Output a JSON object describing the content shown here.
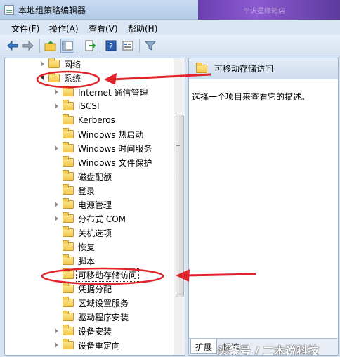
{
  "window": {
    "title": "本地组策略编辑器",
    "background_text": "平沢星缘箱店"
  },
  "menu": [
    {
      "label": "文件(F)"
    },
    {
      "label": "操作(A)"
    },
    {
      "label": "查看(V)"
    },
    {
      "label": "帮助(H)"
    }
  ],
  "toolbar": {
    "icons": [
      "back-arrow-icon",
      "forward-arrow-icon",
      "up-folder-icon",
      "show-tree-icon",
      "export-list-icon",
      "help-icon",
      "properties-icon",
      "filter-icon"
    ]
  },
  "tree": [
    {
      "label": "网络",
      "expander": "collapsed",
      "level": 0
    },
    {
      "label": "系统",
      "expander": "expanded",
      "level": 0
    },
    {
      "label": "Internet 通信管理",
      "expander": "collapsed",
      "level": 1
    },
    {
      "label": "iSCSI",
      "expander": "collapsed",
      "level": 1
    },
    {
      "label": "Kerberos",
      "expander": "none",
      "level": 1
    },
    {
      "label": "Windows 热启动",
      "expander": "none",
      "level": 1
    },
    {
      "label": "Windows 时间服务",
      "expander": "collapsed",
      "level": 1
    },
    {
      "label": "Windows 文件保护",
      "expander": "none",
      "level": 1
    },
    {
      "label": "磁盘配额",
      "expander": "none",
      "level": 1
    },
    {
      "label": "登录",
      "expander": "none",
      "level": 1
    },
    {
      "label": "电源管理",
      "expander": "collapsed",
      "level": 1
    },
    {
      "label": "分布式 COM",
      "expander": "collapsed",
      "level": 1
    },
    {
      "label": "关机选项",
      "expander": "none",
      "level": 1
    },
    {
      "label": "恢复",
      "expander": "none",
      "level": 1
    },
    {
      "label": "脚本",
      "expander": "none",
      "level": 1
    },
    {
      "label": "可移动存储访问",
      "expander": "none",
      "level": 1,
      "selected": true
    },
    {
      "label": "凭据分配",
      "expander": "none",
      "level": 1
    },
    {
      "label": "区域设置服务",
      "expander": "none",
      "level": 1
    },
    {
      "label": "驱动程序安装",
      "expander": "none",
      "level": 1
    },
    {
      "label": "设备安装",
      "expander": "collapsed",
      "level": 1
    },
    {
      "label": "设备重定向",
      "expander": "collapsed",
      "level": 1
    }
  ],
  "right_pane": {
    "header": "可移动存储访问",
    "description": "选择一个项目来查看它的描述。",
    "tabs": [
      "扩展",
      "标准"
    ]
  },
  "watermark": "头条号 / 二木说科技",
  "colors": {
    "annotation_red": "#e0242b",
    "folder_yellow": "#f5c94a",
    "window_blue": "#d6e3f2"
  }
}
